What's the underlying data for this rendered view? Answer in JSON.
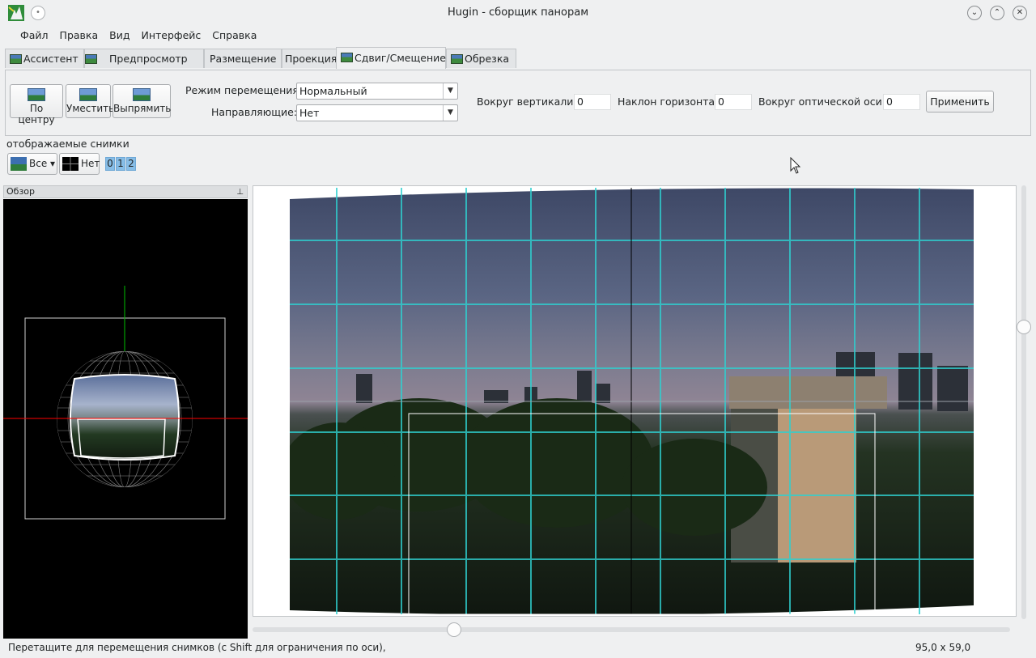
{
  "window": {
    "title": "Hugin - сборщик панорам",
    "controls": {
      "minimize": "⌄",
      "maximize": "⌃",
      "close": "✕"
    }
  },
  "menu": [
    "Файл",
    "Правка",
    "Вид",
    "Интерфейс",
    "Справка"
  ],
  "tabs": [
    "Ассистент",
    "Предпросмотр",
    "Размещение",
    "Проекция",
    "Сдвиг/Смещение",
    "Обрезка"
  ],
  "active_tab": "Сдвиг/Смещение",
  "toolbar": {
    "center_label": "По центру",
    "fit_label": "Уместить",
    "straighten_label": "Выпрямить",
    "drag_mode_label": "Режим перемещения:",
    "drag_mode_value": "Нормальный",
    "guides_label": "Направляющие:",
    "guides_value": "Нет",
    "yaw_label": "Вокруг вертикали:",
    "yaw_value": "0",
    "pitch_label": "Наклон горизонта:",
    "pitch_value": "0",
    "roll_label": "Вокруг оптической оси:",
    "roll_value": "0",
    "apply_label": "Применить"
  },
  "displayed_images": {
    "label": "отображаемые снимки",
    "all_label": "Все",
    "none_label": "Нет",
    "images": [
      "0",
      "1",
      "2"
    ]
  },
  "overview": {
    "title": "Обзор",
    "pin_icon": "pin-icon"
  },
  "status": {
    "message": "Перетащите для перемещения снимков (с Shift для ограничения по оси),",
    "coords": "95,0 x 59,0"
  },
  "colors": {
    "grid": "#2fd0d0",
    "horizon_line": "#ff0000",
    "vertical_line": "#00c000"
  }
}
